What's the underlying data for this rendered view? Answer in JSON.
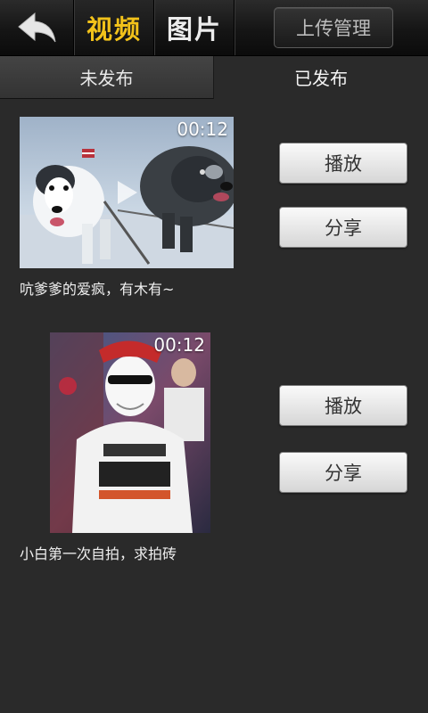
{
  "header": {
    "back_icon": "back-arrow-icon",
    "tab_video": "视频",
    "tab_image": "图片",
    "upload_manage": "上传管理",
    "accent_color": "#f2c21a"
  },
  "segments": {
    "unpublished": "未发布",
    "published": "已发布"
  },
  "videos": [
    {
      "duration": "00:12",
      "caption": "吭爹爹的爱疯，有木有~",
      "play_label": "播放",
      "share_label": "分享"
    },
    {
      "duration": "00:12",
      "caption": "小白第一次自拍，求拍砖",
      "play_label": "播放",
      "share_label": "分享"
    }
  ]
}
